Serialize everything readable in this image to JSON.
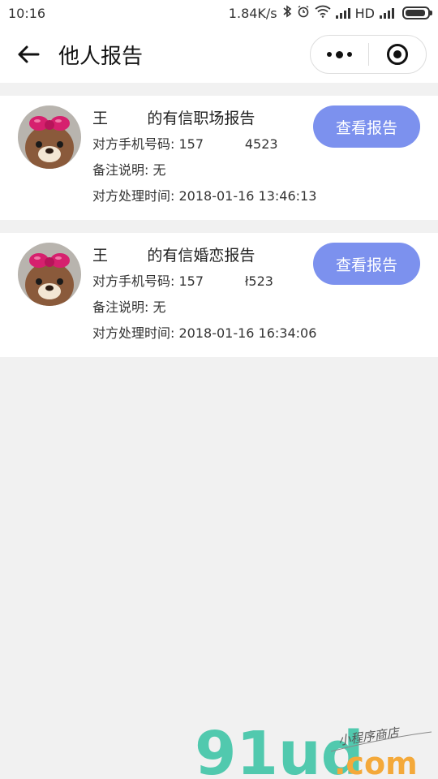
{
  "status_bar": {
    "time": "10:16",
    "speed": "1.84K/s",
    "network": "HD"
  },
  "nav": {
    "title": "他人报告"
  },
  "reports": [
    {
      "title": "王        的有信职场报告",
      "phone_line": "对方手机号码: 157          4523",
      "note_line": "备注说明: 无",
      "time_line": "对方处理时间: 2018-01-16 13:46:13",
      "button_label": "查看报告"
    },
    {
      "title": "王        的有信婚恋报告",
      "phone_line": "对方手机号码: 157          ł523",
      "note_line": "备注说明: 无",
      "time_line": "对方处理时间: 2018-01-16 16:34:06",
      "button_label": "查看报告"
    }
  ],
  "watermark": {
    "brand": "91ud",
    "domain": ".com",
    "tagline": "小程序商店"
  },
  "colors": {
    "accent_button": "#7c91ee",
    "background": "#f1f1f1",
    "card": "#ffffff"
  }
}
